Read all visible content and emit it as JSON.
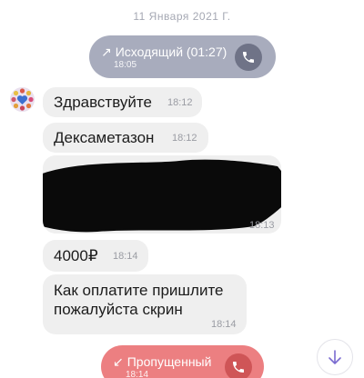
{
  "chat": {
    "date_separator": "11 Января 2021 Г."
  },
  "outgoing_call": {
    "arrow": "↗",
    "label": "Исходящий (01:27)",
    "time": "18:05",
    "icon": "phone-icon",
    "color": "#a8acbd"
  },
  "messages": [
    {
      "text": "Здравствуйте",
      "time": "18:12"
    },
    {
      "text": "Дексаметазон",
      "time": "18:12"
    },
    {
      "text": "",
      "redacted": true,
      "time": "18:13"
    },
    {
      "text": "4000₽",
      "time": "18:14"
    },
    {
      "lines": [
        "Как оплатите пришлите",
        "пожалуйста скрин"
      ],
      "time": "18:14"
    }
  ],
  "missed_call": {
    "arrow": "↙",
    "label": "Пропущенный",
    "time": "18:14",
    "icon": "phone-icon",
    "color": "#ec7f81"
  },
  "controls": {
    "scroll_down_icon": "arrow-down-icon"
  }
}
